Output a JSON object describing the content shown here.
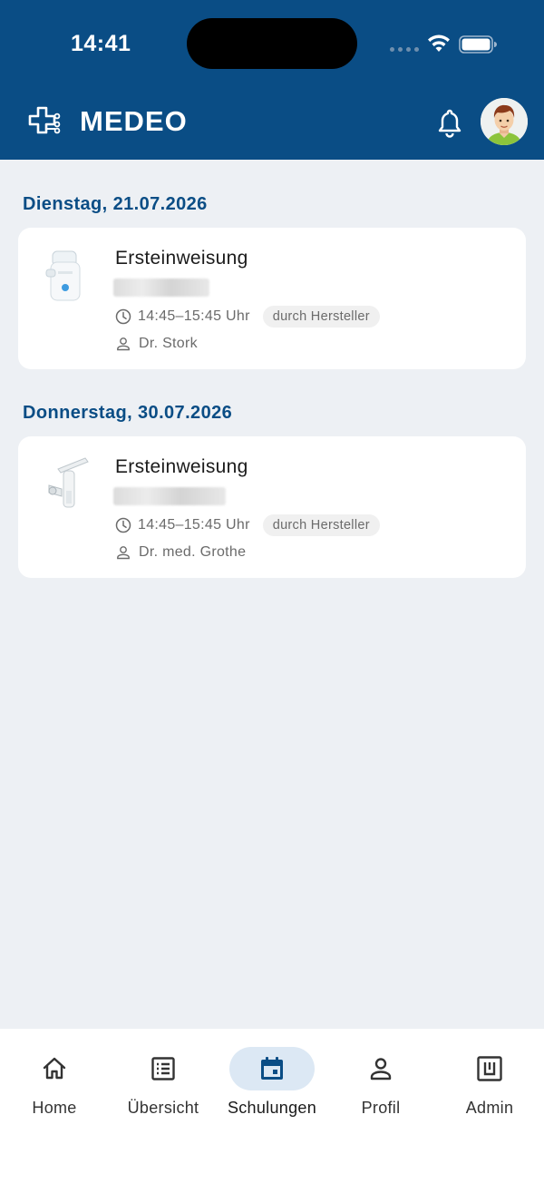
{
  "status_bar": {
    "time": "14:41"
  },
  "app_bar": {
    "title": "MEDEO"
  },
  "sections": [
    {
      "date": "Dienstag, 21.07.2026",
      "card": {
        "title": "Ersteinweisung",
        "time": "14:45–15:45 Uhr",
        "badge": "durch Hersteller",
        "person": "Dr. Stork"
      }
    },
    {
      "date": "Donnerstag, 30.07.2026",
      "card": {
        "title": "Ersteinweisung",
        "time": "14:45–15:45 Uhr",
        "badge": "durch Hersteller",
        "person": "Dr. med. Grothe"
      }
    }
  ],
  "nav": {
    "items": [
      {
        "label": "Home",
        "icon": "home-icon"
      },
      {
        "label": "Übersicht",
        "icon": "list-icon"
      },
      {
        "label": "Schulungen",
        "icon": "calendar-icon",
        "active": true
      },
      {
        "label": "Profil",
        "icon": "person-icon"
      },
      {
        "label": "Admin",
        "icon": "admin-icon"
      }
    ]
  },
  "colors": {
    "header": "#0a4d85",
    "background": "#edf0f4",
    "nav_active": "#dce8f4",
    "section_date": "#0a4d85"
  }
}
